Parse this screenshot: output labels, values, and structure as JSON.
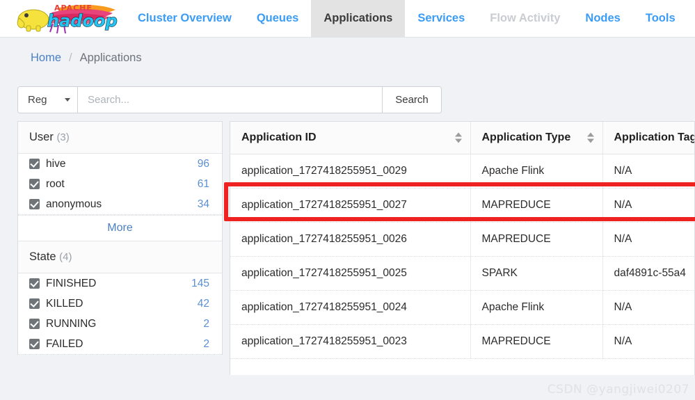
{
  "navbar": {
    "logo_alt": "Apache Hadoop",
    "logo_top_text": "APACHE",
    "logo_main_text": "hadoop",
    "items": [
      {
        "label": "Cluster Overview",
        "active": false,
        "disabled": false
      },
      {
        "label": "Queues",
        "active": false,
        "disabled": false
      },
      {
        "label": "Applications",
        "active": true,
        "disabled": false
      },
      {
        "label": "Services",
        "active": false,
        "disabled": false
      },
      {
        "label": "Flow Activity",
        "active": false,
        "disabled": true
      },
      {
        "label": "Nodes",
        "active": false,
        "disabled": false
      },
      {
        "label": "Tools",
        "active": false,
        "disabled": false
      }
    ]
  },
  "breadcrumb": {
    "home": "Home",
    "separator": "/",
    "current": "Applications"
  },
  "search": {
    "select_value": "Reg",
    "placeholder": "Search...",
    "input_value": "",
    "button_label": "Search"
  },
  "sidebar": {
    "user_panel": {
      "title": "User",
      "count": "(3)",
      "more_label": "More",
      "items": [
        {
          "label": "hive",
          "count": "96",
          "checked": true
        },
        {
          "label": "root",
          "count": "61",
          "checked": true
        },
        {
          "label": "anonymous",
          "count": "34",
          "checked": true
        }
      ]
    },
    "state_panel": {
      "title": "State",
      "count": "(4)",
      "items": [
        {
          "label": "FINISHED",
          "count": "145",
          "checked": true
        },
        {
          "label": "KILLED",
          "count": "42",
          "checked": true
        },
        {
          "label": "RUNNING",
          "count": "2",
          "checked": true
        },
        {
          "label": "FAILED",
          "count": "2",
          "checked": true
        }
      ]
    }
  },
  "table": {
    "columns": [
      {
        "label": "Application ID",
        "sortable": true
      },
      {
        "label": "Application Type",
        "sortable": true
      },
      {
        "label": "Application Tag",
        "sortable": true
      }
    ],
    "rows": [
      {
        "app_id": "application_1727418255951_0029",
        "app_type": "Apache Flink",
        "app_tag": "N/A",
        "highlighted": true
      },
      {
        "app_id": "application_1727418255951_0027",
        "app_type": "MAPREDUCE",
        "app_tag": "N/A",
        "highlighted": false
      },
      {
        "app_id": "application_1727418255951_0026",
        "app_type": "MAPREDUCE",
        "app_tag": "N/A",
        "highlighted": false
      },
      {
        "app_id": "application_1727418255951_0025",
        "app_type": "SPARK",
        "app_tag": "daf4891c-55a4",
        "highlighted": false
      },
      {
        "app_id": "application_1727418255951_0024",
        "app_type": "Apache Flink",
        "app_tag": "N/A",
        "highlighted": false
      },
      {
        "app_id": "application_1727418255951_0023",
        "app_type": "MAPREDUCE",
        "app_tag": "N/A",
        "highlighted": false
      }
    ]
  },
  "watermark": "CSDN @yangjiwei0207",
  "colors": {
    "nav_link": "#3b9cf5",
    "link": "#4a86c8",
    "active_tab_bg": "#e3e3e3",
    "highlight_red": "#ef2222",
    "page_bg": "#f0f2f5"
  }
}
